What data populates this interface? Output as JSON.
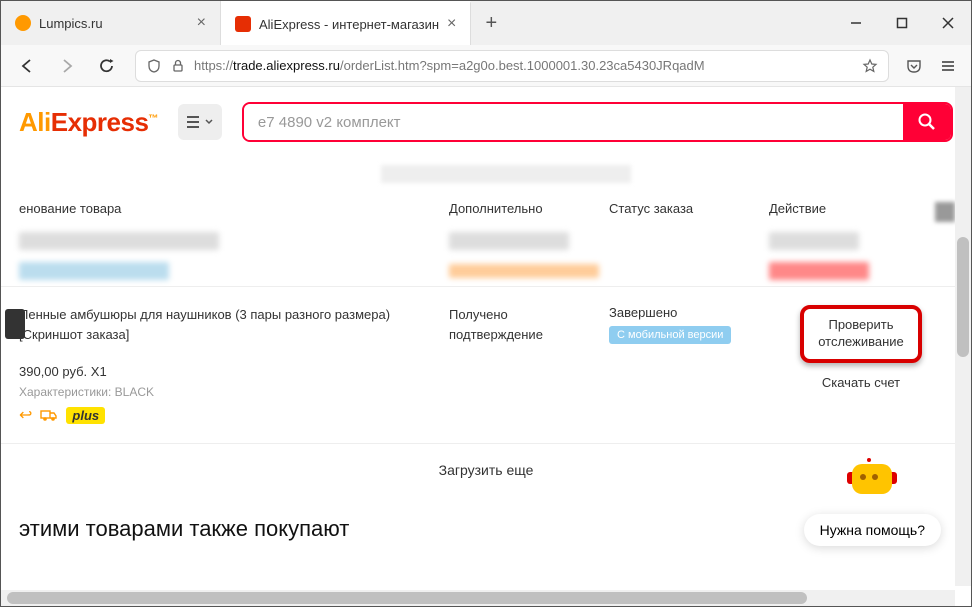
{
  "browser": {
    "tabs": [
      {
        "title": "Lumpics.ru",
        "favicon_color": "#f90",
        "active": false
      },
      {
        "title": "AliExpress - интернет-магазин",
        "favicon_color": "#e62e04",
        "active": true
      }
    ],
    "url_prefix": "https://",
    "url_domain": "trade.aliexpress.ru",
    "url_path": "/orderList.htm?spm=a2g0o.best.1000001.30.23ca5430JRqadM"
  },
  "header": {
    "logo_part1": "Ali",
    "logo_part2": "Express",
    "search_value": "e7 4890 v2 комплект"
  },
  "table": {
    "headers": {
      "name": "енование товара",
      "extra": "Дополнительно",
      "status": "Статус заказа",
      "action": "Действие"
    }
  },
  "order": {
    "title": "Пенные амбушюры для наушников (3 пары разного размера)",
    "subtitle": "[Скриншот заказа]",
    "price": "390,00 руб. X1",
    "characteristics_label": "Характеристики: BLACK",
    "plus_label": "plus",
    "extra_line1": "Получено",
    "extra_line2": "подтверждение",
    "status_text": "Завершено",
    "mobile_badge": "С мобильной версии",
    "track_line1": "Проверить",
    "track_line2": "отслеживание",
    "download_invoice": "Скачать счет"
  },
  "load_more": "Загрузить еще",
  "also_buy": "этими товарами также покупают",
  "help_button": "Нужна помощь?"
}
